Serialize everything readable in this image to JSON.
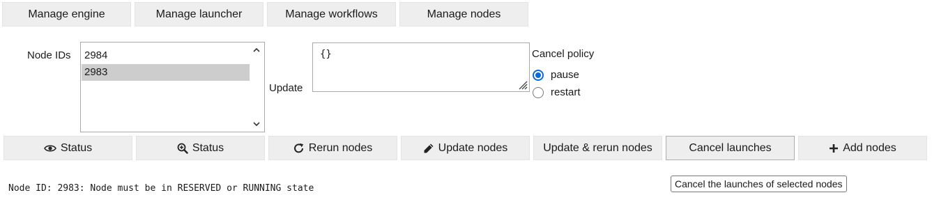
{
  "top_tabs": [
    {
      "label": "Manage engine"
    },
    {
      "label": "Manage launcher"
    },
    {
      "label": "Manage workflows"
    },
    {
      "label": "Manage nodes"
    }
  ],
  "node_ids": {
    "label": "Node IDs",
    "items": [
      "2984",
      "2983"
    ],
    "selected": "2983"
  },
  "update": {
    "label": "Update",
    "value": "{}"
  },
  "cancel_policy": {
    "label": "Cancel policy",
    "options": [
      "pause",
      "restart"
    ],
    "selected": "pause"
  },
  "actions": {
    "status_label": "Status",
    "status_detail_label": "Status",
    "rerun_label": "Rerun nodes",
    "update_label": "Update nodes",
    "update_rerun_label": "Update & rerun nodes",
    "cancel_label": "Cancel launches",
    "add_label": "Add nodes"
  },
  "output_message": "Node ID: 2983: Node must be in RESERVED or RUNNING state",
  "tooltip": "Cancel the launches of selected nodes",
  "colors": {
    "accent": "#0a6ad8",
    "button_bg": "#eeeeee",
    "selected_row": "#cdcdcd",
    "focus_border": "#8fb3d9"
  },
  "icons": {
    "status": "eye-icon",
    "status_detail": "zoom-in-icon",
    "rerun": "redo-icon",
    "update": "pencil-icon",
    "add": "plus-icon"
  }
}
